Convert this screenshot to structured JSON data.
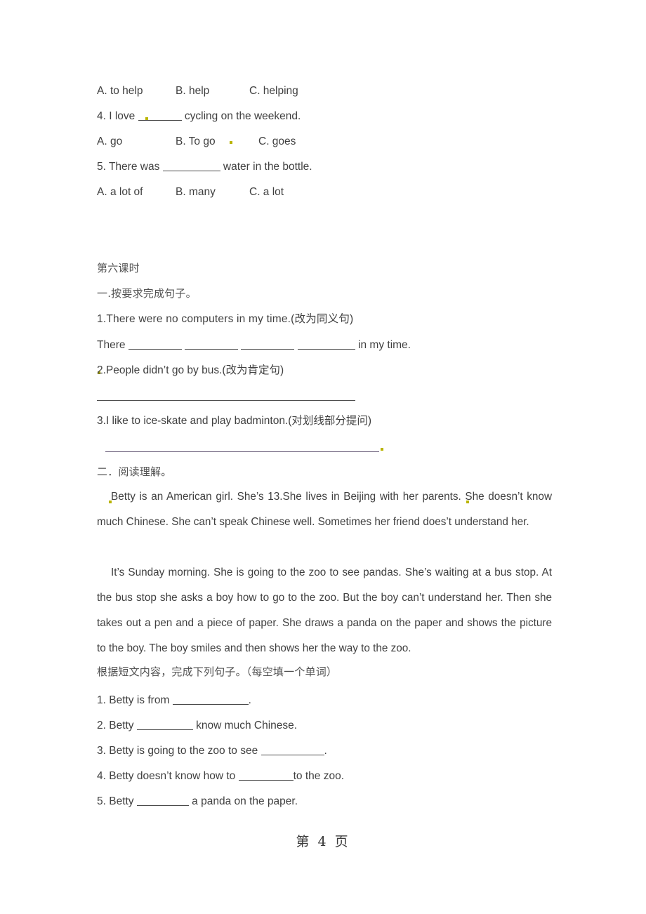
{
  "document": {
    "page_footer": "第 4 页"
  },
  "section_top": {
    "q3_options": [
      {
        "label": "A. to help"
      },
      {
        "label": "B. help"
      },
      {
        "label": "C. helping"
      }
    ],
    "q4_stem_before": "4. I love ",
    "q4_stem_after": " cycling on the weekend.",
    "q4_options": [
      {
        "label": "A. go"
      },
      {
        "label": "B. To go"
      },
      {
        "label": "C. goes"
      }
    ],
    "q5_stem_before": "5. There was ",
    "q5_stem_after": " water in the bottle.",
    "q5_options": [
      {
        "label": "A. a lot of"
      },
      {
        "label": "B. many"
      },
      {
        "label": "C. a lot"
      }
    ]
  },
  "section_six": {
    "heading": "第六课时",
    "part_one_heading": "一.按要求完成句子。",
    "item1": "1.There were no computers in my time.(改为同义句)",
    "item1_answer_before": "There ",
    "item1_answer_after": " in my time.",
    "item2": "2.People didn’t go by bus.(改为肯定句)",
    "item3": "3.I like to ice-skate and play badminton.(对划线部分提问)"
  },
  "section_reading": {
    "heading": "二．阅读理解。",
    "paragraph1": "Betty is an American girl. She’s 13.She lives in Beijing with her parents. She doesn’t know much Chinese. She can’t speak Chinese well. Sometimes her friend does’t understand her.",
    "paragraph2": "It’s Sunday morning. She is going to the zoo to see pandas. She’s waiting at a bus stop. At the bus stop she asks a boy how to go to the zoo. But the boy can’t understand her. Then she takes out a pen and a piece of paper. She draws a panda on the paper and shows the picture to the boy. The boy smiles and then shows her the way to the zoo.",
    "instruction": "根据短文内容，完成下列句子。（每空填一个单词）",
    "questions": [
      {
        "before": "1. Betty is from ",
        "after": "."
      },
      {
        "before": "2. Betty ",
        "after": " know much Chinese."
      },
      {
        "before": "3. Betty is going to the zoo to see ",
        "after": "."
      },
      {
        "before": "4. Betty doesn’t know how to ",
        "after": "to the zoo."
      },
      {
        "before": "5. Betty ",
        "after": " a panda on the paper."
      }
    ]
  }
}
